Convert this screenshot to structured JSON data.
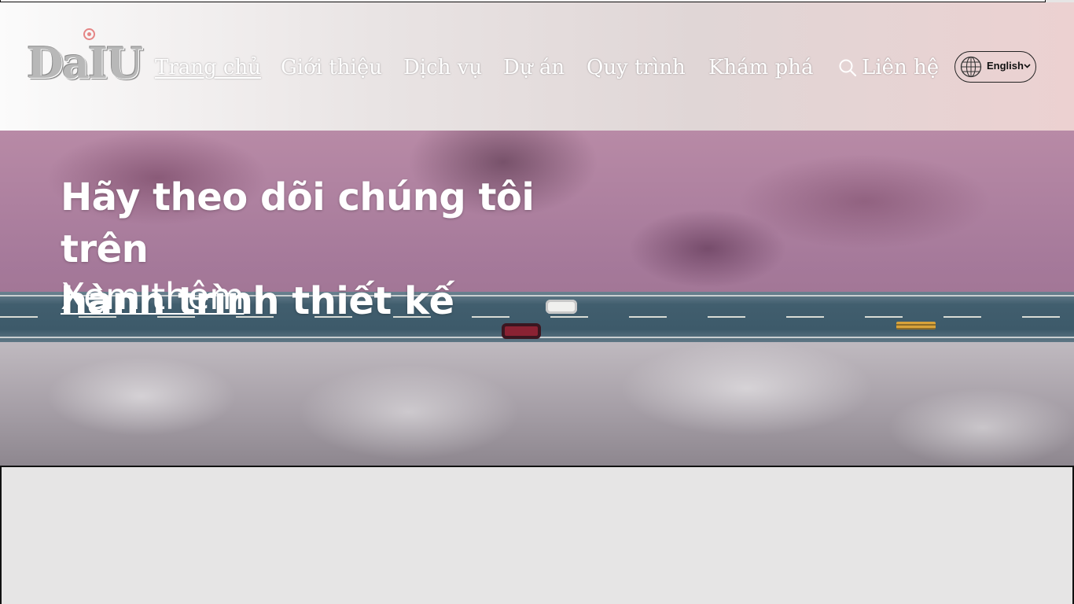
{
  "logo": {
    "text": "DaIU"
  },
  "nav": {
    "items": [
      {
        "label": "Trang chủ",
        "active": true
      },
      {
        "label": "Giới thiệu"
      },
      {
        "label": "Dịch vụ"
      },
      {
        "label": "Dự án"
      },
      {
        "label": "Quy trình"
      },
      {
        "label": "Khám phá"
      }
    ],
    "search_icon": "search-icon",
    "contact_label": "Liên hệ"
  },
  "language": {
    "label": "English",
    "icon": "globe-icon"
  },
  "hero": {
    "title_line1": "Hãy theo dõi chúng tôi trên",
    "title_line2": "hành trình thiết kế",
    "link_label": "Xem thêm"
  },
  "colors": {
    "nav_text": "#ffffff",
    "logo_accent": "#e58585",
    "panel_bg": "#e6e5e5"
  }
}
